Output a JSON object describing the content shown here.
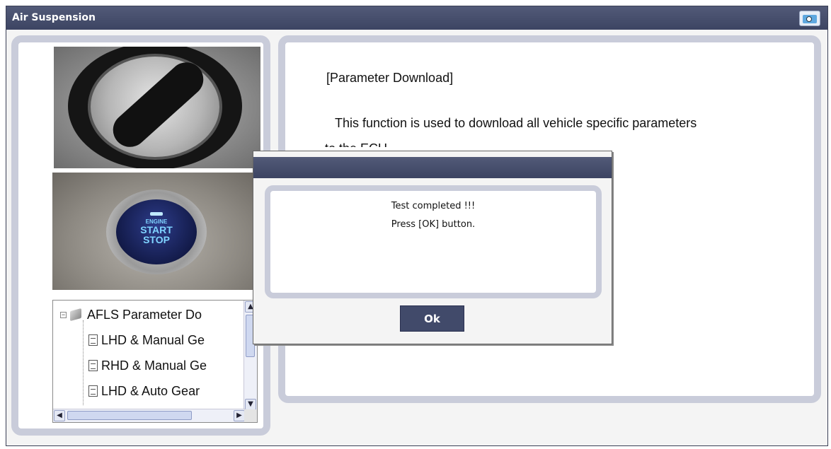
{
  "window": {
    "title": "Air Suspension",
    "camera_icon": "camera-icon"
  },
  "tree": {
    "root": "AFLS Parameter Do",
    "items": [
      {
        "label": "LHD & Manual Ge"
      },
      {
        "label": "RHD & Manual Ge"
      },
      {
        "label": "LHD & Auto Gear"
      }
    ]
  },
  "content": {
    "heading": "[Parameter Download]",
    "description": "This function is used to download all vehicle specific parameters",
    "description_cont": "to the ECU."
  },
  "dialog": {
    "message1": "Test completed !!!",
    "message2": "Press [OK] button.",
    "ok_label": "Ok"
  },
  "colors": {
    "titlebar": "#3c4462",
    "panel_border": "#c9ccda",
    "ok_button": "#414a6a"
  }
}
